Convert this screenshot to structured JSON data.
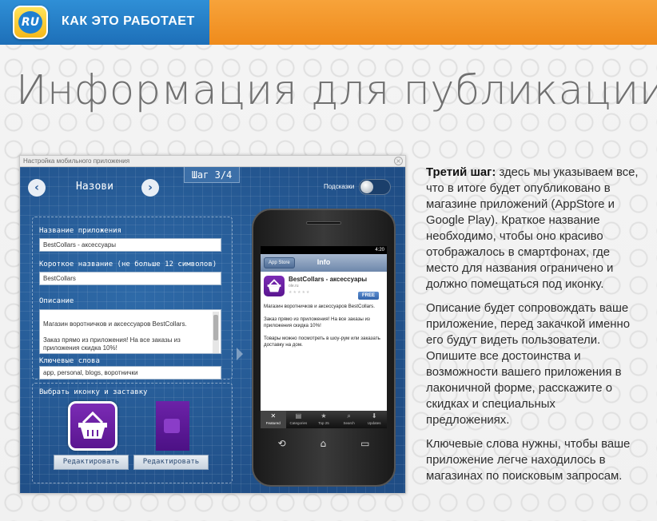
{
  "header": {
    "logo_text": "RU",
    "title": "КАК ЭТО РАБОТАЕТ"
  },
  "page": {
    "title": "Информация для публикации"
  },
  "app_window": {
    "title": "Настройка мобильного приложения",
    "step": "Шаг 3/4",
    "nav_title": "Назови",
    "hints_label": "Подсказки",
    "hints_enabled": false,
    "fields": {
      "app_name_label": "Название приложения",
      "app_name_value": "BestCollars - аксессуары",
      "short_name_label": "Короткое название (не больше 12 символов)",
      "short_name_value": "BestCollars",
      "description_label": "Описание",
      "description_value": "Магазин воротничков и аксессуаров BestCollars.\n\nЗаказ прямо из приложения! На все заказы из приложения скидка 10%!\n\nТовары можно посмотреть в шоу-рум или заказать",
      "keywords_label": "Ключевые слова",
      "keywords_value": "app, personal, blogs, воротнички"
    },
    "icon_section": {
      "label": "Выбрать иконку и заставку",
      "edit_icon_button": "Редактировать",
      "edit_splash_button": "Редактировать"
    }
  },
  "phone": {
    "status_time": "4:20",
    "back_button": "App Store",
    "nav_title": "Info",
    "app_name": "BestCollars - аксессуары",
    "site": "ole.ru",
    "stars": "★★★★★",
    "free_badge": "FREE",
    "description": "Магазин воротничков и аксессуаров BestCollars.\n\nЗаказ прямо из приложения! На все заказы из приложения скидка 10%!\n\nТовары можно посмотреть в шоу-рум или заказать доставку на дом.",
    "tabs": [
      {
        "label": "Featured",
        "icon": "✕"
      },
      {
        "label": "Categories",
        "icon": "▤"
      },
      {
        "label": "Top 25",
        "icon": "★"
      },
      {
        "label": "Search",
        "icon": "⌕"
      },
      {
        "label": "Updates",
        "icon": "⬇"
      }
    ]
  },
  "description": {
    "p1_bold": "Третий шаг:",
    "p1_text": " здесь мы указываем все, что в итоге будет опубликовано в магазине приложений (AppStore и Google Play). Краткое название необходимо, чтобы оно красиво отображалось в смартфонах, где место для названия ограничено и должно помещаться под иконку.",
    "p2": "Описание будет сопровождать ваше приложение, перед закачкой именно его будут видеть пользователи. Опишите все достоинства и возможности вашего приложения в лаконичной форме, расскажите о скидках и специальных предложениях.",
    "p3": "Ключевые слова нужны, чтобы ваше приложение легче находилось в магазинах по поисковым запросам."
  },
  "colors": {
    "header_blue": "#2f8fd6",
    "header_orange": "#f7a33a",
    "blueprint": "#24568f",
    "app_purple": "#6a1fa3"
  }
}
